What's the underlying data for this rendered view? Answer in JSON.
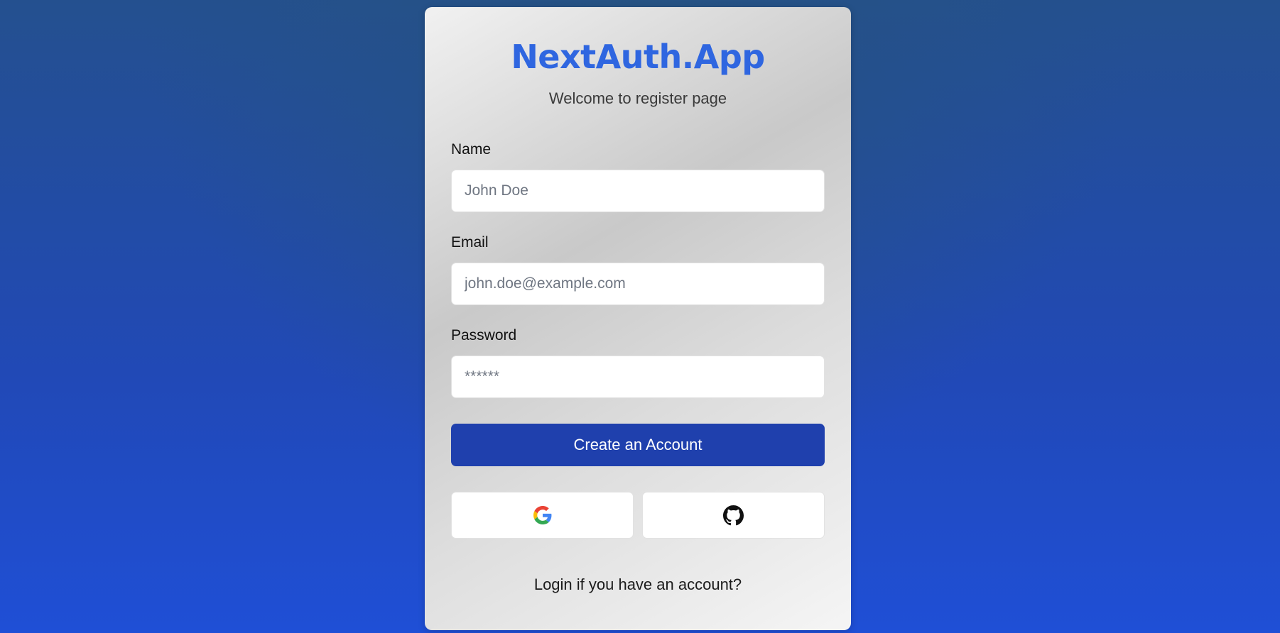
{
  "app": {
    "title": "NextAuth.App",
    "subtitle": "Welcome to register page"
  },
  "form": {
    "name": {
      "label": "Name",
      "placeholder": "John Doe",
      "value": ""
    },
    "email": {
      "label": "Email",
      "placeholder": "john.doe@example.com",
      "value": ""
    },
    "password": {
      "label": "Password",
      "placeholder": "******",
      "value": ""
    },
    "submit_label": "Create an Account"
  },
  "oauth": [
    {
      "provider": "google",
      "icon": "google-icon"
    },
    {
      "provider": "github",
      "icon": "github-icon"
    }
  ],
  "footer": {
    "login_link": "Login if you have an account?"
  },
  "colors": {
    "brand": "#2f66e0",
    "primary_button": "#1f40ad",
    "background_top": "#24508f",
    "background_bottom": "#1f4fd6"
  }
}
